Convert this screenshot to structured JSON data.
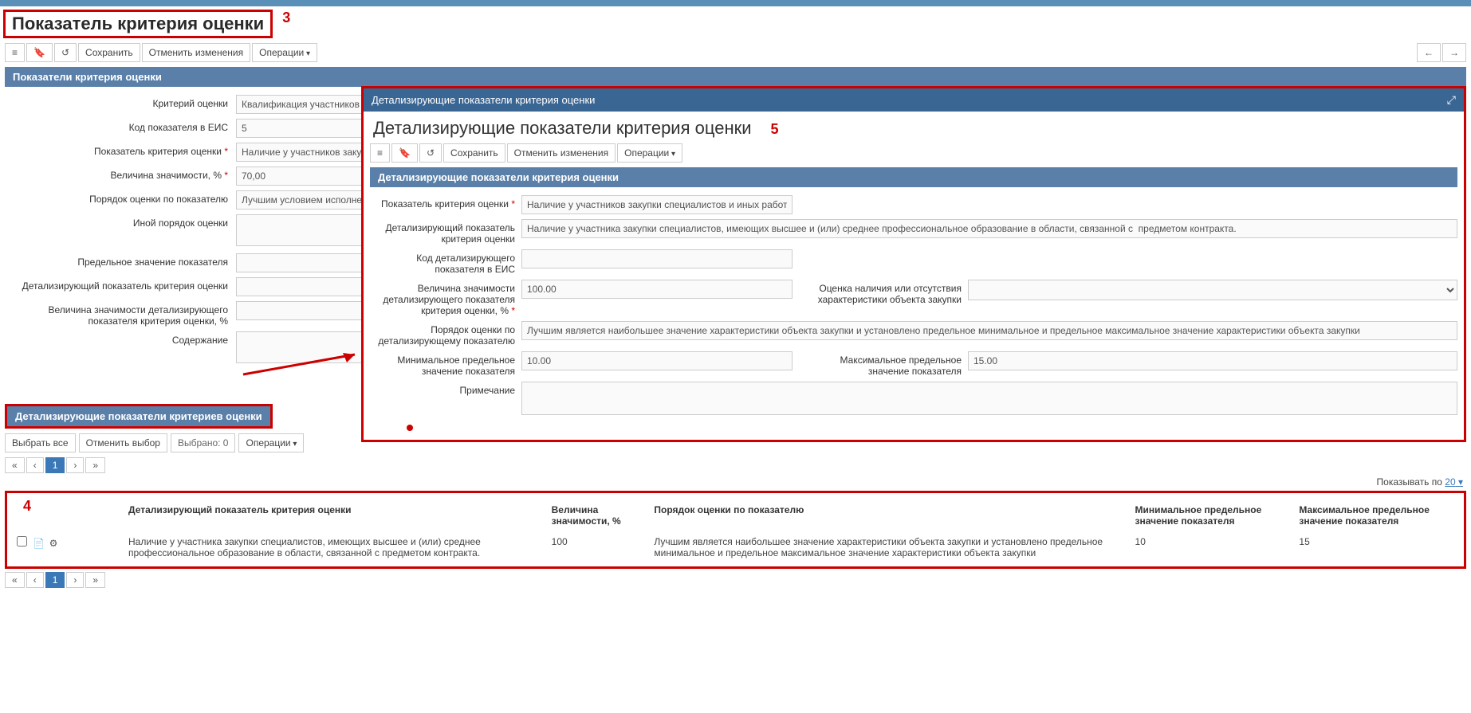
{
  "page": {
    "title": "Показатель критерия оценки",
    "annot": "3"
  },
  "toolbar": {
    "save": "Сохранить",
    "cancel": "Отменить изменения",
    "ops": "Операции"
  },
  "section1": {
    "header": "Показатели критерия оценки",
    "fields": {
      "crit_label": "Критерий оценки",
      "crit_value": "Квалификация участников закупки, в том числе наличие у них финансовых ресурсов, на праве собственности или ином законном основании оборудования и других материальных ресурсов, опыта работы, связанного с предметом контракта, и деловой репутации, специалистов и ...",
      "code_label": "Код показателя в ЕИС",
      "code_value": "5",
      "ind_label": "Показатель критерия оценки",
      "ind_value": "Наличие у участников закупки специ",
      "sig_label": "Величина значимости, %",
      "sig_value": "70,00",
      "order_label": "Порядок оценки по показателю",
      "order_value": "Лучшим условием исполнения конт",
      "other_label": "Иной порядок оценки",
      "limit_label": "Предельное значение показателя",
      "detail_label": "Детализирующий показатель критерия оценки",
      "detsig_label": "Величина значимости детализирующего показателя критерия оценки, %",
      "content_label": "Содержание"
    }
  },
  "section2": {
    "header": "Детализирующие показатели критериев оценки",
    "select_all": "Выбрать все",
    "clear_sel": "Отменить выбор",
    "selected": "Выбрано: 0",
    "ops": "Операции",
    "show_by_label": "Показывать по",
    "show_by_value": "20",
    "table_annot": "4",
    "cols": {
      "c1": "Детализирующий показатель критерия оценки",
      "c2": "Величина значимости, %",
      "c3": "Порядок оценки по показателю",
      "c4": "Минимальное предельное значение показателя",
      "c5": "Максимальное предельное значение показателя"
    },
    "row": {
      "c1": "Наличие у участника закупки специалистов, имеющих высшее и (или) среднее профессиональное образование в области, связанной с предметом контракта.",
      "c2": "100",
      "c3": "Лучшим является наибольшее значение характеристики объекта закупки и установлено предельное минимальное и предельное максимальное значение характеристики объекта закупки",
      "c4": "10",
      "c5": "15"
    }
  },
  "modal": {
    "header": "Детализирующие показатели критерия оценки",
    "title": "Детализирующие показатели критерия оценки",
    "annot": "5",
    "section_header": "Детализирующие показатели критерия оценки",
    "fields": {
      "ind_label": "Показатель критерия оценки",
      "ind_value": "Наличие у участников закупки специалистов и иных работников определ",
      "det_label": "Детализирующий показатель критерия оценки",
      "det_value": "Наличие у участника закупки специалистов, имеющих высшее и (или) среднее профессиональное образование в области, связанной с  предметом контракта.",
      "code_label": "Код детализирующего показателя в ЕИС",
      "sig_label": "Величина значимости детализирующего показателя критерия оценки, %",
      "sig_value": "100.00",
      "eval_label": "Оценка наличия или отсутствия характеристики объекта закупки",
      "order_label": "Порядок оценки по детализирующему показателю",
      "order_value": "Лучшим является наибольшее значение характеристики объекта закупки и установлено предельное минимальное и предельное максимальное значение характеристики объекта закупки",
      "min_label": "Минимальное предельное значение показателя",
      "min_value": "10.00",
      "max_label": "Максимальное предельное значение показателя",
      "max_value": "15.00",
      "note_label": "Примечание"
    }
  },
  "pager": {
    "page": "1"
  }
}
